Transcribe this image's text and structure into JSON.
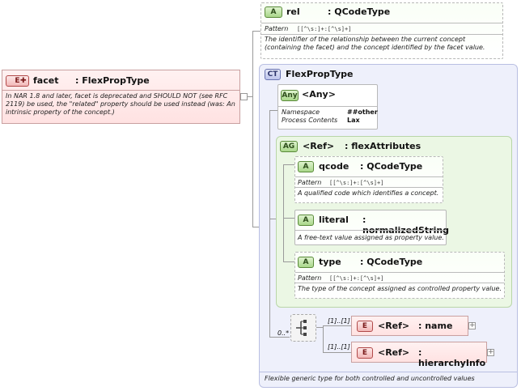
{
  "facet": {
    "badge": "E",
    "name": "facet",
    "type": ": FlexPropType",
    "description": "In NAR 1.8 and later, facet is deprecated and SHOULD NOT (see RFC 2119) be used, the \"related\" property should be used instead (was: An intrinsic property of the concept.)"
  },
  "rel": {
    "badge": "A",
    "name": "rel",
    "type": ": QCodeType",
    "pattern_label": "Pattern",
    "pattern_value": "[[^\\s:]+:[^\\s]+]",
    "description": "The identifier of the relationship between the current concept (containing the facet) and the concept identified by the facet value."
  },
  "flexproptype": {
    "badge": "CT",
    "title": "FlexPropType",
    "footer": "Flexible generic type for both controlled and uncontrolled values"
  },
  "any": {
    "badge": "Any",
    "name": "<Any>",
    "namespace_label": "Namespace",
    "namespace_value": "##other",
    "process_label": "Process Contents",
    "process_value": "Lax"
  },
  "flexattributes": {
    "badge": "AG",
    "name": "<Ref>",
    "type": ": flexAttributes"
  },
  "qcode": {
    "badge": "A",
    "name": "qcode",
    "type": ": QCodeType",
    "pattern_label": "Pattern",
    "pattern_value": "[[^\\s:]+:[^\\s]+]",
    "description": "A qualified code which identifies a concept."
  },
  "literal": {
    "badge": "A",
    "name": "literal",
    "type": ": normalizedString",
    "description": "A free-text value assigned as property value."
  },
  "typeattr": {
    "badge": "A",
    "name": "type",
    "type": ": QCodeType",
    "pattern_label": "Pattern",
    "pattern_value": "[[^\\s:]+:[^\\s]+]",
    "description": "The type of the concept assigned as controlled property value."
  },
  "sequence": {
    "cardinality": "0..*"
  },
  "name_el": {
    "badge": "E",
    "cardinality": "[1]..[1]",
    "name": "<Ref>",
    "type": ": name"
  },
  "hierarchyinfo_el": {
    "badge": "E",
    "cardinality": "[1]..[1]",
    "name": "<Ref>",
    "type": ": hierarchyInfo"
  }
}
